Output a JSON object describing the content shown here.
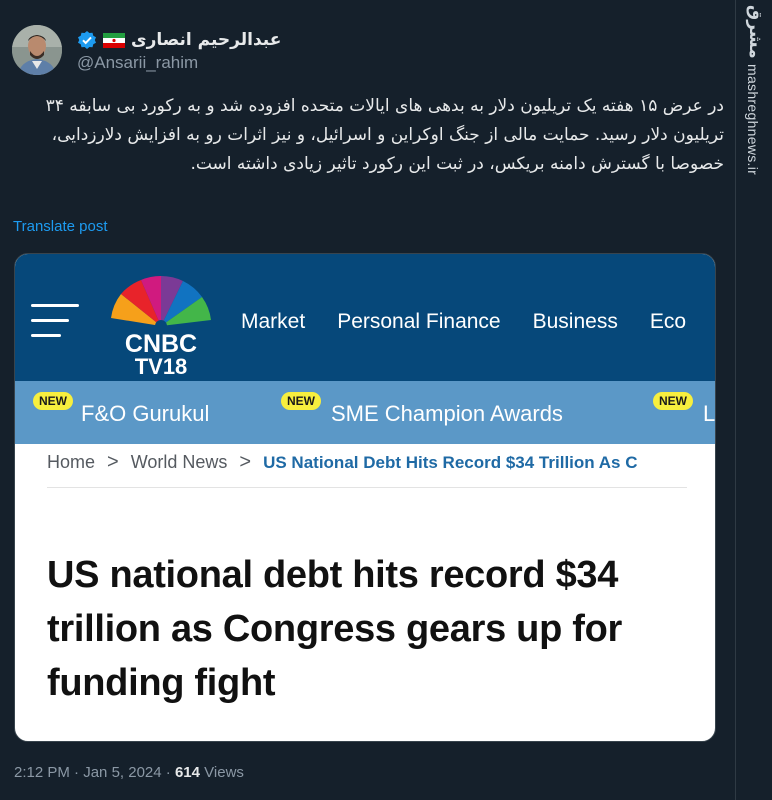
{
  "tweet": {
    "display_name": "عبدالرحیم انصاری",
    "handle": "@Ansarii_rahim",
    "flag_icon": "iran-flag-icon",
    "verified_icon": "verified-badge-icon",
    "more_icon": "more-options-icon",
    "body": "در عرض ۱۵ هفته یک تریلیون دلار به بدهی های ایالات متحده افزوده شد و به رکورد بی سابقه ۳۴ تریلیون دلار رسید. حمایت مالی از جنگ اوکراین و اسرائیل، و نیز اثرات رو به افزایش دلارزدایی، خصوصا با گسترش دامنه بریکس، در ثبت این رکورد تاثیر زیادی داشته است.",
    "translate_label": "Translate post",
    "time": "2:12 PM",
    "date": "Jan 5, 2024",
    "separator": "·",
    "views_count": "614",
    "views_label": "Views"
  },
  "card": {
    "logo_line1": "CNBC",
    "logo_line2": "TV18",
    "menu_icon": "hamburger-menu-icon",
    "nav": [
      "Market",
      "Personal Finance",
      "Business",
      "Eco"
    ],
    "subnav": [
      {
        "badge": "NEW",
        "label": "F&O Gurukul"
      },
      {
        "badge": "NEW",
        "label": "SME Champion Awards"
      },
      {
        "badge": "NEW",
        "label": "L"
      }
    ],
    "breadcrumb": {
      "home": "Home",
      "section": "World News",
      "current": "US National Debt Hits Record $34 Trillion As C",
      "chevron": ">"
    },
    "headline": "US national debt hits record $34 trillion as Congress gears up for funding fight",
    "colors": {
      "header_bg": "#06487a",
      "subnav_bg": "#5b98c7",
      "badge_bg": "#f7ef3e",
      "breadcrumb_current": "#1f6aa5"
    }
  },
  "watermark": {
    "logo": "مشرق",
    "site": "mashreghnews.ir"
  }
}
